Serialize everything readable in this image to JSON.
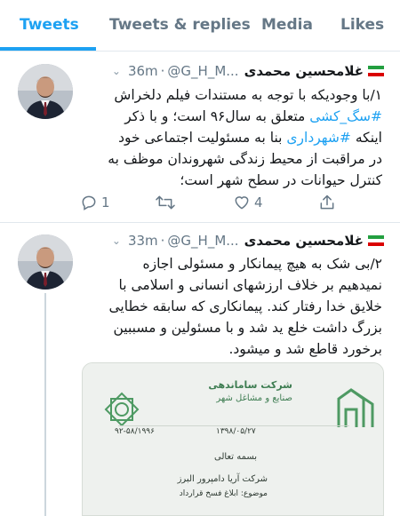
{
  "tabs": [
    {
      "label": "Tweets",
      "active": true
    },
    {
      "label": "Tweets & replies",
      "active": false
    },
    {
      "label": "Media",
      "active": false
    },
    {
      "label": "Likes",
      "active": false
    }
  ],
  "tweets": [
    {
      "author_name": "غلامحسین محمدی",
      "handle": "@G_H_M...",
      "time": "36m",
      "lines": [
        [
          {
            "t": "۱/با وجودیکه با توجه به مستندات فیلم دلخراش"
          }
        ],
        [
          {
            "t": "#سگ_کشی",
            "tag": true
          },
          {
            "t": " متعلق به سال۹۶ است؛ و با ذکر"
          }
        ],
        [
          {
            "t": "اینکه "
          },
          {
            "t": "#شهرداری",
            "tag": true
          },
          {
            "t": " بنا به مسئولیت اجتماعی خود"
          }
        ],
        [
          {
            "t": "در مراقبت از محیط زندگی شهروندان موظف به"
          }
        ],
        [
          {
            "t": "کنترل حیوانات در سطح شهر است؛"
          }
        ]
      ],
      "reply_count": "1",
      "retweet_count": "",
      "like_count": "4"
    },
    {
      "author_name": "غلامحسین محمدی",
      "handle": "@G_H_M...",
      "time": "33m",
      "lines": [
        [
          {
            "t": "۲/بی شک به هیچ پیمانکار و مسئولی اجازه"
          }
        ],
        [
          {
            "t": "نمیدهیم بر خلاف ارزشهای انسانی و اسلامی با"
          }
        ],
        [
          {
            "t": "خلایق خدا رفتار کند. پیمانکاری که سابقه خطایی"
          }
        ],
        [
          {
            "t": "بزرگ داشت خلع ید شد و با مسئولین و مسببین"
          }
        ],
        [
          {
            "t": "برخورد قاطع شد و میشود."
          }
        ]
      ]
    }
  ],
  "document": {
    "company_line1": "شرکت ساماندهی",
    "company_line2": "صنایع و مشاغل شهر",
    "date": "۱۳۹۸/۰۵/۲۷",
    "number": "۹۲-۵۸/۱۹۹۶",
    "greeting": "بسمه تعالی",
    "recipient": "شرکت آریا دامپرور البرز",
    "subject": "موضوع: ابلاغ فسخ قرارداد"
  },
  "colors": {
    "accent": "#1da1f2",
    "muted": "#657786",
    "divider": "#e1e8ed"
  }
}
